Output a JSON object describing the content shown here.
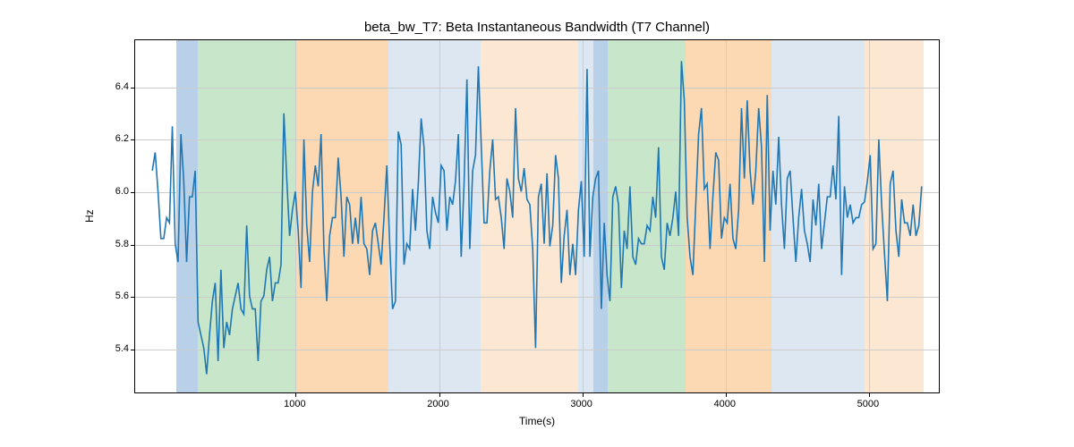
{
  "chart_data": {
    "type": "line",
    "title": "beta_bw_T7: Beta Instantaneous Bandwidth (T7 Channel)",
    "xlabel": "Time(s)",
    "ylabel": "Hz",
    "xlim": [
      -120,
      5500
    ],
    "ylim": [
      5.23,
      6.58
    ],
    "xticks": [
      1000,
      2000,
      3000,
      4000,
      5000
    ],
    "yticks": [
      5.4,
      5.6,
      5.8,
      6.0,
      6.2,
      6.4
    ],
    "background_bands": [
      {
        "xstart": 170,
        "xend": 320,
        "color": "#b9d0e9"
      },
      {
        "xstart": 320,
        "xend": 1000,
        "color": "#c8e6c9"
      },
      {
        "xstart": 1000,
        "xend": 1650,
        "color": "#fcd8b3"
      },
      {
        "xstart": 1650,
        "xend": 2290,
        "color": "#dde7f2"
      },
      {
        "xstart": 2290,
        "xend": 2970,
        "color": "#fbe7d2"
      },
      {
        "xstart": 2970,
        "xend": 3080,
        "color": "#dde7f2"
      },
      {
        "xstart": 3080,
        "xend": 3180,
        "color": "#b9d0e9"
      },
      {
        "xstart": 3180,
        "xend": 3720,
        "color": "#c8e6c9"
      },
      {
        "xstart": 3720,
        "xend": 4320,
        "color": "#fcd8b3"
      },
      {
        "xstart": 4320,
        "xend": 4970,
        "color": "#dde7f2"
      },
      {
        "xstart": 4970,
        "xend": 5380,
        "color": "#fbe7d2"
      }
    ],
    "x": [
      0,
      20,
      40,
      60,
      80,
      100,
      120,
      140,
      160,
      180,
      200,
      220,
      240,
      260,
      280,
      300,
      320,
      340,
      360,
      380,
      400,
      420,
      440,
      460,
      480,
      500,
      520,
      540,
      560,
      580,
      600,
      620,
      640,
      660,
      680,
      700,
      720,
      740,
      760,
      780,
      800,
      820,
      840,
      860,
      880,
      900,
      920,
      940,
      960,
      980,
      1000,
      1020,
      1040,
      1060,
      1080,
      1100,
      1120,
      1140,
      1160,
      1180,
      1200,
      1220,
      1240,
      1260,
      1280,
      1300,
      1320,
      1340,
      1360,
      1380,
      1400,
      1420,
      1440,
      1460,
      1480,
      1500,
      1520,
      1540,
      1560,
      1580,
      1600,
      1620,
      1640,
      1660,
      1680,
      1700,
      1720,
      1740,
      1760,
      1780,
      1800,
      1820,
      1840,
      1860,
      1880,
      1900,
      1920,
      1940,
      1960,
      1980,
      2000,
      2020,
      2040,
      2060,
      2080,
      2100,
      2120,
      2140,
      2160,
      2180,
      2200,
      2220,
      2240,
      2260,
      2280,
      2300,
      2320,
      2340,
      2360,
      2380,
      2400,
      2420,
      2440,
      2460,
      2480,
      2500,
      2520,
      2540,
      2560,
      2580,
      2600,
      2620,
      2640,
      2660,
      2680,
      2700,
      2720,
      2740,
      2760,
      2780,
      2800,
      2820,
      2840,
      2860,
      2880,
      2900,
      2920,
      2940,
      2960,
      2980,
      3000,
      3020,
      3040,
      3060,
      3080,
      3100,
      3120,
      3140,
      3160,
      3180,
      3200,
      3220,
      3240,
      3260,
      3280,
      3300,
      3320,
      3340,
      3360,
      3380,
      3400,
      3420,
      3440,
      3460,
      3480,
      3500,
      3520,
      3540,
      3560,
      3580,
      3600,
      3620,
      3640,
      3660,
      3680,
      3700,
      3720,
      3740,
      3760,
      3780,
      3800,
      3820,
      3840,
      3860,
      3880,
      3900,
      3920,
      3940,
      3960,
      3980,
      4000,
      4020,
      4040,
      4060,
      4080,
      4100,
      4120,
      4140,
      4160,
      4180,
      4200,
      4220,
      4240,
      4260,
      4280,
      4300,
      4320,
      4340,
      4360,
      4380,
      4400,
      4420,
      4440,
      4460,
      4480,
      4500,
      4520,
      4540,
      4560,
      4580,
      4600,
      4620,
      4640,
      4660,
      4680,
      4700,
      4720,
      4740,
      4760,
      4780,
      4800,
      4820,
      4840,
      4860,
      4880,
      4900,
      4920,
      4940,
      4960,
      4980,
      5000,
      5020,
      5040,
      5060,
      5080,
      5100,
      5120,
      5140,
      5160,
      5180,
      5200,
      5220,
      5240,
      5260,
      5280,
      5300,
      5320,
      5340,
      5360,
      5380
    ],
    "values": [
      6.08,
      6.15,
      6.0,
      5.82,
      5.82,
      5.9,
      5.88,
      6.25,
      5.8,
      5.73,
      6.22,
      6.04,
      5.73,
      5.98,
      5.98,
      6.08,
      5.5,
      5.45,
      5.4,
      5.3,
      5.45,
      5.58,
      5.65,
      5.35,
      5.7,
      5.4,
      5.5,
      5.45,
      5.55,
      5.6,
      5.65,
      5.55,
      5.53,
      5.87,
      5.6,
      5.55,
      5.55,
      5.35,
      5.58,
      5.6,
      5.7,
      5.75,
      5.58,
      5.65,
      5.65,
      5.72,
      6.3,
      6.05,
      5.83,
      5.93,
      6.0,
      5.85,
      5.63,
      6.2,
      5.87,
      5.73,
      6.0,
      6.1,
      6.02,
      6.22,
      5.78,
      5.58,
      5.83,
      5.9,
      5.9,
      6.13,
      5.98,
      5.75,
      5.98,
      5.95,
      5.8,
      5.9,
      5.8,
      5.98,
      5.8,
      5.78,
      5.68,
      5.85,
      5.88,
      5.8,
      5.72,
      5.9,
      6.1,
      5.8,
      5.55,
      5.58,
      6.23,
      6.18,
      5.72,
      5.8,
      5.78,
      6.01,
      5.85,
      6.03,
      6.28,
      6.17,
      5.85,
      5.78,
      5.98,
      5.92,
      5.88,
      6.1,
      6.08,
      5.85,
      5.98,
      5.95,
      6.04,
      6.22,
      5.75,
      6.03,
      6.43,
      5.78,
      6.08,
      6.14,
      6.48,
      6.18,
      5.88,
      5.88,
      6.08,
      6.2,
      5.97,
      5.98,
      5.9,
      5.78,
      6.05,
      6.0,
      5.9,
      6.32,
      6.05,
      6.0,
      6.09,
      5.97,
      5.95,
      5.78,
      5.4,
      5.98,
      6.03,
      5.8,
      6.07,
      5.79,
      5.87,
      6.14,
      6.05,
      5.65,
      5.83,
      5.93,
      5.68,
      5.8,
      5.68,
      5.93,
      6.04,
      5.75,
      6.47,
      5.75,
      5.98,
      6.05,
      6.08,
      5.55,
      5.88,
      5.68,
      5.58,
      5.98,
      6.02,
      5.95,
      5.63,
      5.85,
      5.78,
      6.02,
      5.75,
      5.72,
      5.82,
      5.8,
      5.8,
      5.87,
      5.85,
      5.98,
      5.9,
      6.17,
      5.75,
      5.7,
      5.88,
      5.83,
      5.9,
      6.0,
      5.83,
      6.5,
      6.35,
      5.9,
      5.75,
      5.68,
      5.95,
      6.22,
      6.32,
      6.01,
      6.03,
      5.78,
      5.98,
      6.15,
      6.12,
      5.82,
      5.9,
      5.88,
      6.03,
      5.82,
      5.78,
      5.93,
      6.32,
      6.05,
      6.35,
      6.08,
      5.95,
      6.08,
      6.32,
      6.17,
      5.73,
      6.37,
      5.85,
      6.08,
      5.95,
      6.21,
      5.95,
      5.78,
      6.05,
      6.08,
      5.9,
      5.73,
      5.9,
      6.01,
      5.85,
      5.8,
      5.73,
      5.97,
      5.87,
      6.03,
      5.78,
      5.88,
      5.98,
      5.98,
      6.1,
      5.97,
      6.29,
      5.68,
      6.02,
      5.9,
      5.95,
      5.88,
      5.9,
      5.9,
      5.95,
      5.96,
      6.04,
      6.14,
      5.78,
      5.8,
      6.2,
      5.95,
      5.76,
      5.58,
      6.03,
      6.08,
      5.85,
      5.75,
      5.97,
      5.88,
      5.88,
      5.83,
      5.95,
      5.83,
      5.87,
      6.02
    ]
  }
}
